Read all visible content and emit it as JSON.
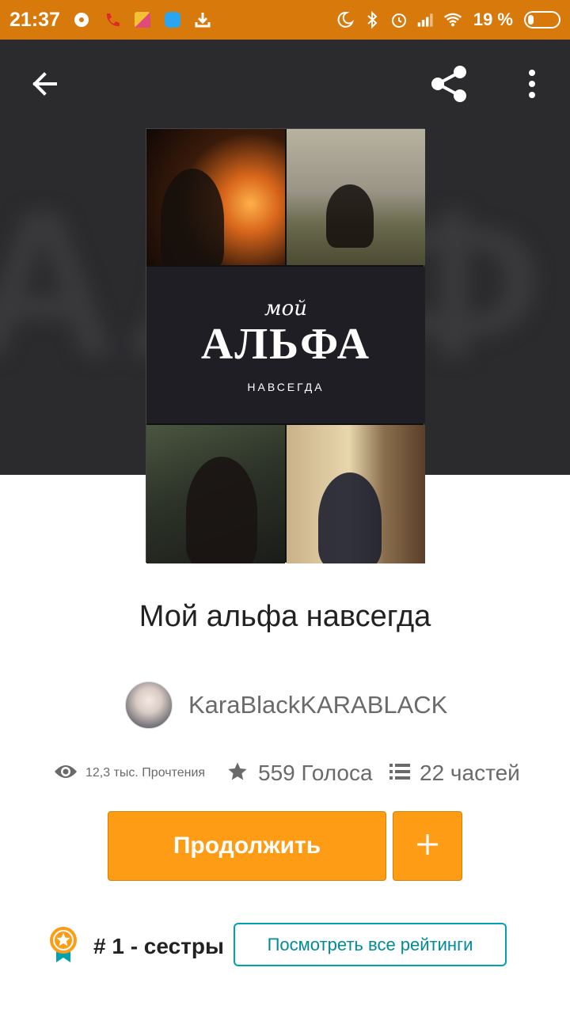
{
  "status_bar": {
    "time": "21:37",
    "battery_percent": "19 %",
    "battery_level": 0.19,
    "left_icons": [
      "download-status-icon",
      "missed-call-icon",
      "app-notification-icon",
      "app-notification-icon",
      "download-icon"
    ],
    "right_icons": [
      "moon-icon",
      "bluetooth-icon",
      "alarm-icon",
      "signal-icon",
      "wifi-icon",
      "battery-icon"
    ]
  },
  "header": {
    "back_icon": "arrow-left-icon",
    "share_icon": "share-icon",
    "more_icon": "more-vertical-icon"
  },
  "cover": {
    "small_title": "мой",
    "big_title": "АЛЬФА",
    "subtitle": "НАВСЕГДА"
  },
  "book": {
    "title": "Мой альфа навсегда",
    "author": "KaraBlackKARABLACK"
  },
  "stats": {
    "reads": "12,3 тыс. Прочтения",
    "votes": "559 Голоса",
    "parts": "22 частей"
  },
  "actions": {
    "continue_label": "Продолжить",
    "add_icon": "plus-icon"
  },
  "ranking": {
    "text": "# 1 - сестры",
    "view_all_label": "Посмотреть все рейтинги"
  },
  "colors": {
    "status_bar": "#d8790c",
    "header_bg": "#2b2b2e",
    "accent_orange": "#ff9c16",
    "teal": "#00a2ae"
  }
}
